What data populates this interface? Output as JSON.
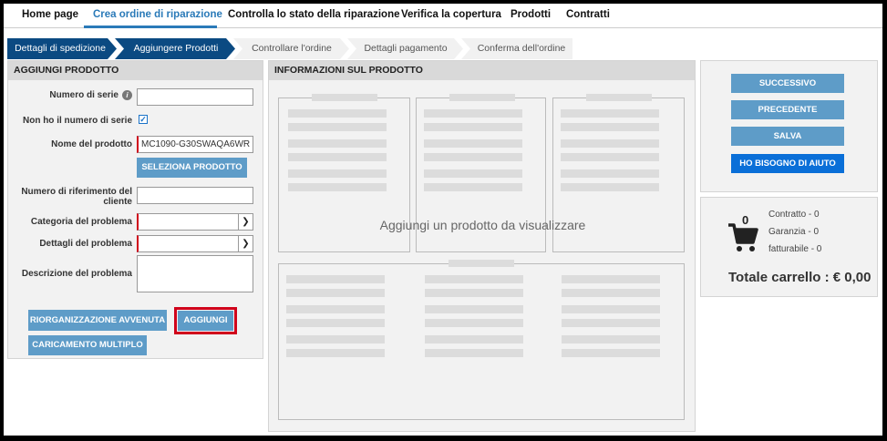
{
  "nav": {
    "items": [
      "Home page",
      "Crea ordine di riparazione",
      "Controlla lo stato della riparazione",
      "Verifica la copertura",
      "Prodotti",
      "Contratti"
    ],
    "active_index": 1
  },
  "steps": [
    "Dettagli di spedizione",
    "Aggiungere Prodotti",
    "Controllare l'ordine",
    "Dettagli pagamento",
    "Conferma dell'ordine"
  ],
  "add_product": {
    "title": "AGGIUNGI PRODOTTO",
    "serial_label": "Numero di serie",
    "serial_value": "",
    "no_serial_label": "Non ho il numero di serie",
    "no_serial_checked": true,
    "product_name_label": "Nome del prodotto",
    "product_name_value": "MC1090-G30SWAQA6WR",
    "select_product_button": "SELEZIONA PRODOTTO",
    "ref_label": "Numero di riferimento del cliente",
    "ref_value": "",
    "category_label": "Categoria del problema",
    "category_value": "",
    "details_label": "Dettagli del problema",
    "details_value": "",
    "description_label": "Descrizione del problema",
    "description_value": "",
    "reorg_button": "RIORGANIZZAZIONE AVVENUTA",
    "add_button": "AGGIUNGI",
    "bulk_button": "CARICAMENTO MULTIPLO"
  },
  "product_info": {
    "title": "INFORMAZIONI SUL PRODOTTO",
    "placeholder": "Aggiungi un prodotto da visualizzare"
  },
  "actions": {
    "next": "SUCCESSIVO",
    "previous": "PRECEDENTE",
    "save": "SALVA",
    "help": "HO BISOGNO DI AIUTO"
  },
  "cart": {
    "count": "0",
    "contract": "Contratto - 0",
    "warranty": "Garanzia - 0",
    "billable": "fatturabile - 0",
    "total": "Totale carrello : € 0,00"
  },
  "colors": {
    "accent": "#2a7ab8",
    "step_done": "#0b4a82",
    "button": "#5e9cc8",
    "help_button": "#0a6fd8",
    "highlight": "#d0021b"
  }
}
